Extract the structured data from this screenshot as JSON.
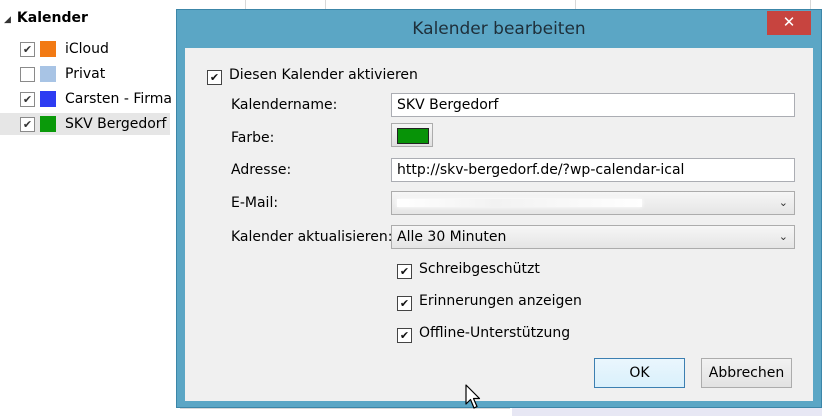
{
  "background": {
    "section_title": "Kalender",
    "calendars": [
      {
        "label": "iCloud",
        "checked": true,
        "color": "#f27a14"
      },
      {
        "label": "Privat",
        "checked": false,
        "color": "#a8c4e5"
      },
      {
        "label": "Carsten - Firma",
        "checked": true,
        "color": "#2d3cf2"
      },
      {
        "label": "SKV Bergedorf",
        "checked": true,
        "color": "#0a9a0a",
        "selected": true
      }
    ]
  },
  "dialog": {
    "title": "Kalender bearbeiten",
    "close_glyph": "✕",
    "activate_label": "Diesen Kalender aktivieren",
    "activate_checked": true,
    "name_label": "Kalendername:",
    "name_value": "SKV Bergedorf",
    "color_label": "Farbe:",
    "color_value": "#079307",
    "address_label": "Adresse:",
    "address_value": "http://skv-bergedorf.de/?wp-calendar-ical",
    "email_label": "E-Mail:",
    "refresh_label": "Kalender aktualisieren:",
    "refresh_value": "Alle 30 Minuten",
    "dropdown_glyph": "⌄",
    "readonly_label": "Schreibgeschützt",
    "readonly_checked": true,
    "reminders_label": "Erinnerungen anzeigen",
    "reminders_checked": true,
    "offline_label": "Offline-Unterstützung",
    "offline_checked": true,
    "ok_label": "OK",
    "cancel_label": "Abbrechen",
    "check_glyph": "✔",
    "accent_color": "#5ba6c5",
    "close_color": "#c7443f"
  }
}
